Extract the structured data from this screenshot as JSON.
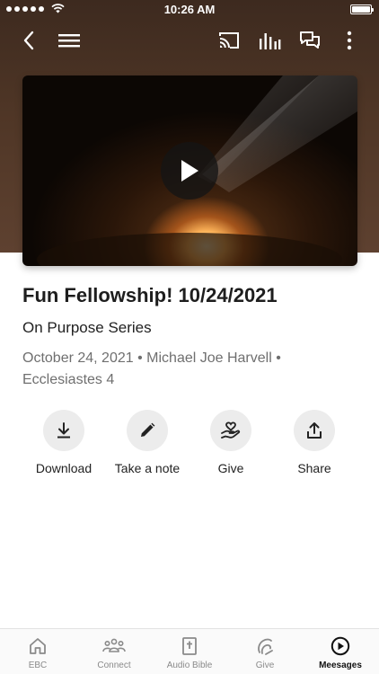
{
  "status": {
    "time": "10:26 AM"
  },
  "sermon": {
    "title": "Fun Fellowship! 10/24/2021",
    "series": "On Purpose Series",
    "date": "October 24, 2021",
    "speaker": "Michael Joe Harvell",
    "scripture": "Ecclesiastes 4",
    "separator": "•"
  },
  "actions": [
    {
      "label": "Download",
      "icon": "download-icon"
    },
    {
      "label": "Take a note",
      "icon": "pencil-icon"
    },
    {
      "label": "Give",
      "icon": "heart-hand-icon"
    },
    {
      "label": "Share",
      "icon": "share-icon"
    }
  ],
  "tabs": [
    {
      "label": "EBC",
      "icon": "home-icon",
      "active": false
    },
    {
      "label": "Connect",
      "icon": "people-icon",
      "active": false
    },
    {
      "label": "Audio Bible",
      "icon": "bible-icon",
      "active": false
    },
    {
      "label": "Give",
      "icon": "give-icon",
      "active": false
    },
    {
      "label": "Meesages",
      "icon": "play-circle-icon",
      "active": true
    }
  ],
  "colors": {
    "header_brown": "#4f3626",
    "action_circle": "#ececec",
    "active_tab": "#111111"
  }
}
